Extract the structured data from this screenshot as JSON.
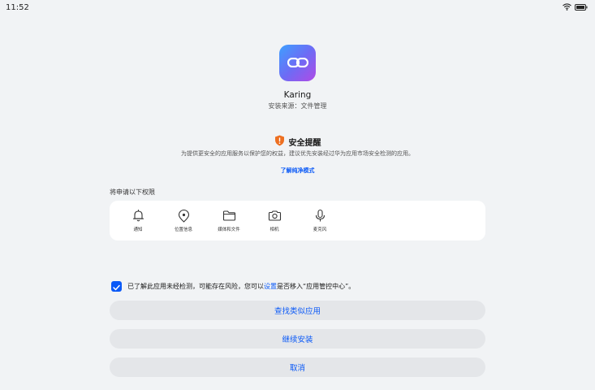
{
  "status_bar": {
    "time": "11:52",
    "icons": [
      "wifi-icon",
      "battery-icon"
    ]
  },
  "app": {
    "name": "Karing",
    "source": "安装来源：文件管理",
    "icon": "link-icon",
    "icon_gradient": [
      "#3ea0ff",
      "#6c6cf5",
      "#b04ae6"
    ]
  },
  "security_warning": {
    "title": "安全提醒",
    "icon": "shield-warning-icon",
    "description": "为提供更安全的应用服务以保护您的权益，建议优先安装经过华为应用市场安全检测的应用。",
    "link": "了解纯净模式"
  },
  "permissions": {
    "heading": "将申请以下权限",
    "items": [
      {
        "label": "通知",
        "icon": "bell-icon"
      },
      {
        "label": "位置信息",
        "icon": "location-icon"
      },
      {
        "label": "媒体和文件",
        "icon": "folder-icon"
      },
      {
        "label": "相机",
        "icon": "camera-icon"
      },
      {
        "label": "麦克风",
        "icon": "microphone-icon"
      }
    ]
  },
  "consent": {
    "checked": true,
    "text_before": "已了解此应用未经检测，可能存在风险，您可以",
    "link": "设置",
    "text_after": "是否移入“应用管控中心”。"
  },
  "buttons": {
    "find_similar": "查找类似应用",
    "continue_install": "继续安装",
    "cancel": "取消"
  },
  "colors": {
    "accent": "#0a59f7",
    "warning": "#ed6f21",
    "background": "#f1f3f5",
    "button_bg": "#e4e6e9"
  }
}
